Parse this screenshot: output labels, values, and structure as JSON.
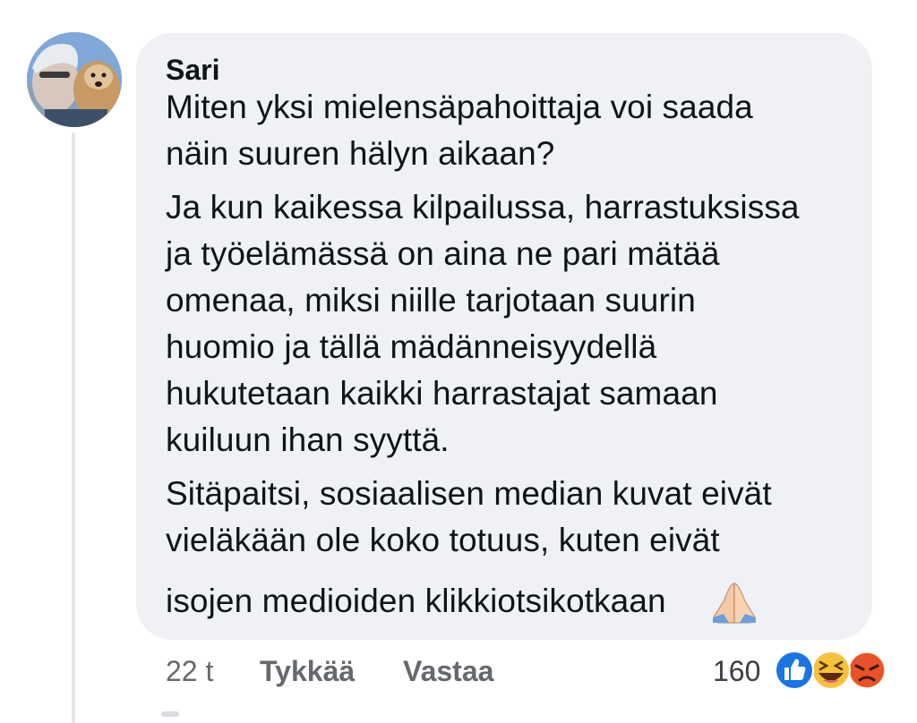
{
  "comment": {
    "author": "Sari",
    "lines": [
      "Miten yksi mielensäpahoittaja voi saada",
      "näin suuren hälyn aikaan?",
      "Ja kun kaikessa kilpailussa, harrastuksissa",
      "ja työelämässä on aina ne pari mätää",
      "omenaa, miksi niille tarjotaan suurin",
      "huomio ja tällä mädänneisyydellä",
      "hukutetaan kaikki harrastajat samaan",
      "kuiluun ihan syyttä.",
      "Sitäpaitsi, sosiaalisen median kuvat eivät",
      "vieläkään ole koko totuus, kuten eivät",
      "isojen medioiden klikkiotsikotkaan"
    ],
    "emoji_icon": "folded-hands-icon"
  },
  "footer": {
    "time": "22 t",
    "like_label": "Tykkää",
    "reply_label": "Vastaa",
    "reaction_count": "160",
    "reactions": [
      "like-reaction-icon",
      "haha-reaction-icon",
      "angry-reaction-icon"
    ]
  },
  "colors": {
    "bubble": "#eff1f4",
    "secondary_text": "#65686c",
    "like_blue": "#1b74e4",
    "haha_yellow": "#f7c23b",
    "angry_orange": "#e8512a"
  }
}
